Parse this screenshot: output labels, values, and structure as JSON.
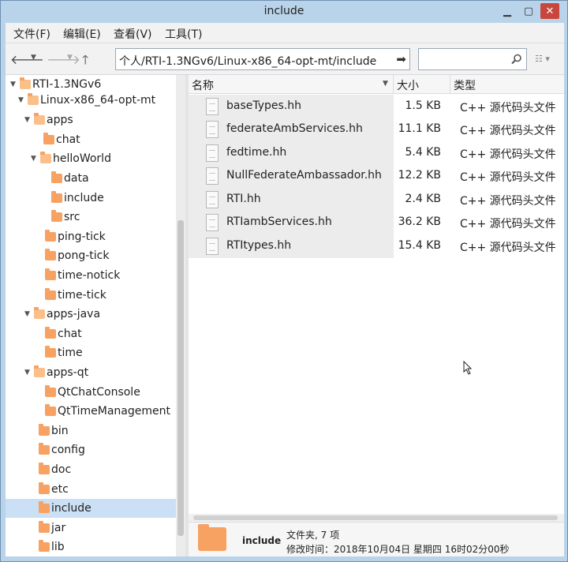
{
  "window": {
    "title": "include"
  },
  "menu": {
    "items": [
      "文件(F)",
      "编辑(E)",
      "查看(V)",
      "工具(T)"
    ]
  },
  "toolbar": {
    "path": "个人/RTI-1.3NGv6/Linux-x86_64-opt-mt/include",
    "search_placeholder": ""
  },
  "tree": {
    "nodes": [
      {
        "label": "RTI-1.3NGv6",
        "expanded": true
      },
      {
        "label": "Linux-x86_64-opt-mt",
        "expanded": true
      },
      {
        "label": "apps",
        "expanded": true
      },
      {
        "label": "chat"
      },
      {
        "label": "helloWorld",
        "expanded": true
      },
      {
        "label": "data"
      },
      {
        "label": "include"
      },
      {
        "label": "src"
      },
      {
        "label": "ping-tick"
      },
      {
        "label": "pong-tick"
      },
      {
        "label": "time-notick"
      },
      {
        "label": "time-tick"
      },
      {
        "label": "apps-java",
        "expanded": true
      },
      {
        "label": "chat"
      },
      {
        "label": "time"
      },
      {
        "label": "apps-qt",
        "expanded": true
      },
      {
        "label": "QtChatConsole"
      },
      {
        "label": "QtTimeManagement"
      },
      {
        "label": "bin"
      },
      {
        "label": "config"
      },
      {
        "label": "doc"
      },
      {
        "label": "etc"
      },
      {
        "label": "include",
        "selected": true
      },
      {
        "label": "jar"
      },
      {
        "label": "lib"
      }
    ]
  },
  "columns": {
    "name": "名称",
    "size": "大小",
    "type": "类型"
  },
  "files": [
    {
      "name": "baseTypes.hh",
      "size": "1.5 KB",
      "type": "C++ 源代码头文件"
    },
    {
      "name": "federateAmbServices.hh",
      "size": "11.1 KB",
      "type": "C++ 源代码头文件"
    },
    {
      "name": "fedtime.hh",
      "size": "5.4 KB",
      "type": "C++ 源代码头文件"
    },
    {
      "name": "NullFederateAmbassador.hh",
      "size": "12.2 KB",
      "type": "C++ 源代码头文件"
    },
    {
      "name": "RTI.hh",
      "size": "2.4 KB",
      "type": "C++ 源代码头文件"
    },
    {
      "name": "RTIambServices.hh",
      "size": "36.2 KB",
      "type": "C++ 源代码头文件"
    },
    {
      "name": "RTItypes.hh",
      "size": "15.4 KB",
      "type": "C++ 源代码头文件"
    }
  ],
  "details": {
    "name": "include",
    "summary": "文件夹, 7 项",
    "modified": "修改时间：2018年10月04日 星期四 16时02分00秒"
  },
  "colors": {
    "titlebar": "#b9d3ea",
    "folder": "#f7a262",
    "selection": "#cce0f5",
    "close": "#c9463d"
  }
}
